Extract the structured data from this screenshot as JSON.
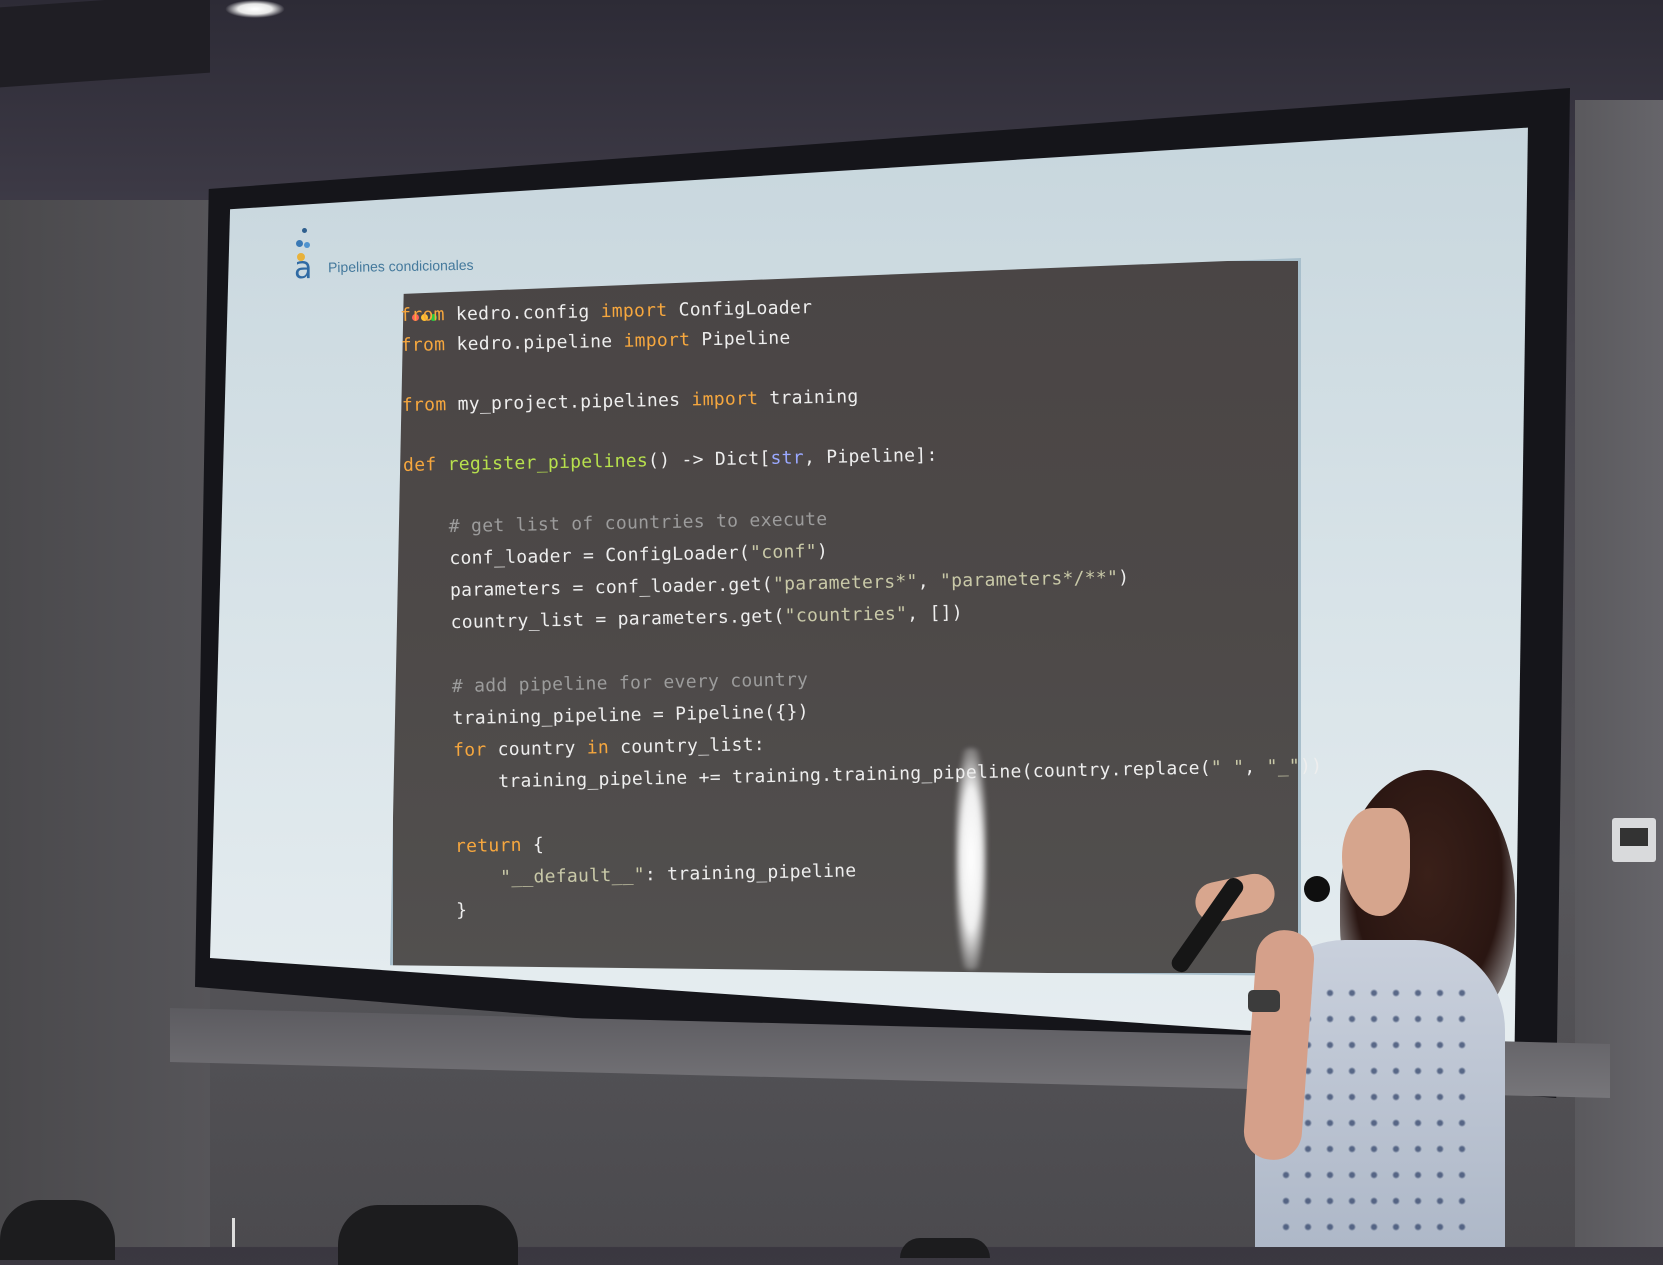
{
  "slide": {
    "title": "Pipelines condicionales",
    "logo_letter": "a"
  },
  "code_window": {
    "traffic_lights": [
      "#ff6157",
      "#ffc12f",
      "#29c941"
    ],
    "lines": [
      "from kedro.config import ConfigLoader",
      "from kedro.pipeline import Pipeline",
      "",
      "from my_project.pipelines import training",
      "",
      "def register_pipelines() -> Dict[str, Pipeline]:",
      "",
      "    # get list of countries to execute",
      "    conf_loader = ConfigLoader(\"conf\")",
      "    parameters = conf_loader.get(\"parameters*\", \"parameters*/**\")",
      "    country_list = parameters.get(\"countries\", [])",
      "",
      "    # add pipeline for every country",
      "    training_pipeline = Pipeline({})",
      "    for country in country_list:",
      "        training_pipeline += training.training_pipeline(country.replace(\" \", \"_\"))",
      "",
      "    return {",
      "        \"__default__\": training_pipeline",
      "    }"
    ]
  },
  "colors": {
    "keyword": "#f6a73e",
    "function": "#b7e04d",
    "builtin": "#9aa8ff",
    "string": "#c9c9a8",
    "comment": "#9c9c9c",
    "code_text": "#eeeeee",
    "code_background": "#4a4545",
    "slide_background": "#d8e3e8"
  }
}
